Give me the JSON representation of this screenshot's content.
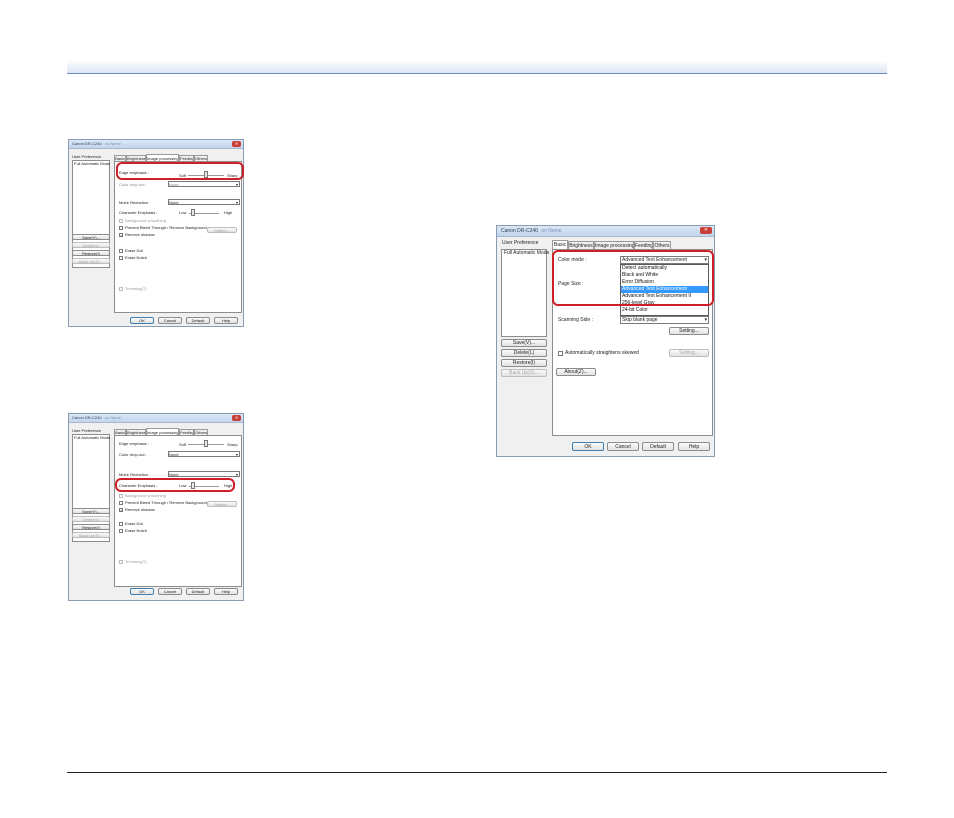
{
  "shot1": {
    "title": "Canon DR-C240",
    "title_suffix": "on Name",
    "user_pref": "User Preference",
    "list_item": "Full Automatic Mode",
    "side_buttons": [
      "Save(V)...",
      "Delete(L)",
      "Restore(I)",
      "Back Up(S)..."
    ],
    "tabs": [
      "Basic",
      "Brightness",
      "Image processing",
      "Feeding",
      "Others"
    ],
    "edge_label": "Edge emphasis :",
    "soft": "Soft",
    "sharp": "Sharp",
    "color_dropout_label": "Color drop-out :",
    "color_dropout_value": "None",
    "moire_label": "Moire Reduction :",
    "moire_value": "None",
    "char_label": "Character Emphasis :",
    "low": "Low",
    "high": "High",
    "bg_smooth": "Background smoothing",
    "prevent_bleed": "Prevent Bleed Through / Remove Background",
    "setting": "Setting...",
    "remove_shadow": "Remove shadow",
    "erase_dot": "Erase Dot",
    "erase_notch": "Erase Notch",
    "trimming": "Trimming(T)",
    "bottom_buttons": [
      "OK",
      "Cancel",
      "Default",
      "Help"
    ]
  },
  "shot2": {
    "title": "Canon DR-C240",
    "title_suffix": "on Name",
    "user_pref": "User Preference",
    "list_item": "Full Automatic Mode",
    "side_buttons": [
      "Save(V)...",
      "Delete(L)",
      "Restore(I)",
      "Back Up(S)..."
    ],
    "tabs": [
      "Basic",
      "Brightness",
      "Image processing",
      "Feeding",
      "Others"
    ],
    "edge_label": "Edge emphasis :",
    "soft": "Soft",
    "sharp": "Sharp",
    "color_dropout_label": "Color drop-out :",
    "color_dropout_value": "None",
    "moire_label": "Moire Reduction :",
    "moire_value": "None",
    "char_label": "Character Emphasis :",
    "low": "Low",
    "high": "High",
    "bg_smooth": "Background smoothing",
    "prevent_bleed": "Prevent Bleed Through / Remove Background",
    "setting": "Setting...",
    "remove_shadow": "Remove shadow",
    "erase_dot": "Erase Dot",
    "erase_notch": "Erase Notch",
    "trimming": "Trimming(T)",
    "bottom_buttons": [
      "OK",
      "Cancel",
      "Default",
      "Help"
    ]
  },
  "shot3": {
    "title": "Canon DR-C240",
    "title_suffix": "on Name",
    "user_pref": "User Preference",
    "list_item": "Full Automatic Mode",
    "side_buttons": [
      "Save(V)...",
      "Delete(L)",
      "Restore(I)",
      "Back Up(S)..."
    ],
    "about": "About(Z)...",
    "tabs": [
      "Basic",
      "Brightness",
      "Image processing",
      "Feeding",
      "Others"
    ],
    "color_mode_label": "Color mode :",
    "color_mode_value": "Advanced Text Enhancement",
    "color_mode_options": [
      "Detect automatically",
      "Black and White",
      "Error Diffusion",
      "Advanced Text Enhancement",
      "Advanced Text Enhancement II",
      "256-level Gray",
      "24-bit Color"
    ],
    "selected_option": "Advanced Text Enhancement",
    "page_size_label": "Page Size :",
    "scanning_side_label": "Scanning Side :",
    "scanning_side_value": "Skip blank page",
    "setting_up": "Setting...",
    "straighten": "Automatically straightens skewed",
    "setting2": "Setting...",
    "bottom_buttons": [
      "OK",
      "Cancel",
      "Default",
      "Help"
    ]
  },
  "colors": {
    "highlight": "#d21f27",
    "selection": "#3399ff",
    "header_rule": "#6c8cc2"
  }
}
